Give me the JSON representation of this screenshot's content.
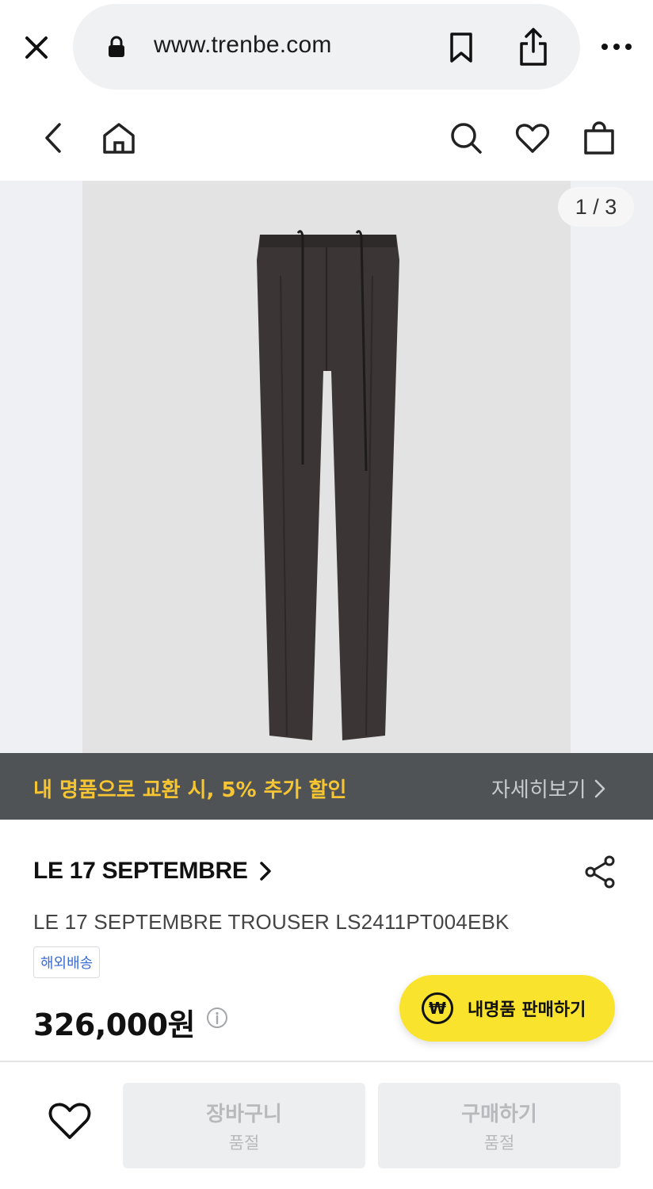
{
  "browser": {
    "url": "www.trenbe.com",
    "close_icon": "close-icon",
    "lock_icon": "lock-icon",
    "bookmark_icon": "bookmark-icon",
    "share_icon": "share-icon",
    "more_icon": "more-icon"
  },
  "header": {
    "back_icon": "chevron-left-icon",
    "home_icon": "home-icon",
    "search_icon": "search-icon",
    "wishlist_icon": "heart-icon",
    "cart_icon": "shopping-bag-icon"
  },
  "gallery": {
    "counter": "1 / 3"
  },
  "promo": {
    "text": "내 명품으로 교환 시, 5% 추가 할인",
    "link_label": "자세히보기"
  },
  "product": {
    "brand": "LE 17 SEPTEMBRE",
    "name": "LE 17 SEPTEMBRE TROUSER LS2411PT004EBK",
    "badge": "해외배송",
    "price": "326,000원",
    "sell_button_label": "내명품 판매하기",
    "sell_icon_symbol": "₩"
  },
  "bottom_bar": {
    "cart_label": "장바구니",
    "cart_status": "품절",
    "buy_label": "구매하기",
    "buy_status": "품절"
  },
  "colors": {
    "promo_bg": "#4f5356",
    "promo_text": "#f7c531",
    "sell_button": "#f9e32d",
    "badge_text": "#3c6cd6"
  }
}
